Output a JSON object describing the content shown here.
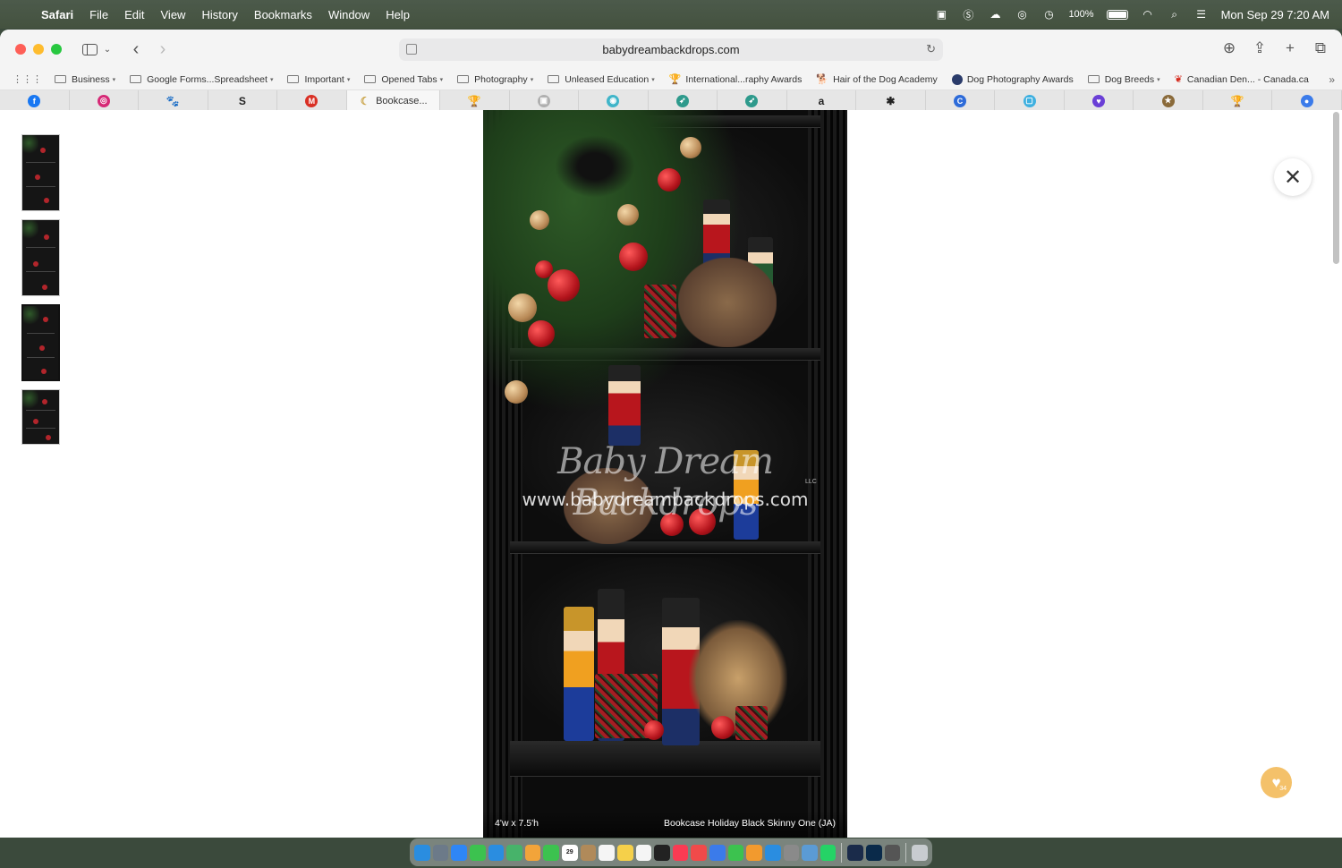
{
  "menubar": {
    "app_name": "Safari",
    "items": [
      "File",
      "Edit",
      "View",
      "History",
      "Bookmarks",
      "Window",
      "Help"
    ],
    "battery": "100%",
    "datetime": "Mon Sep 29  7:20 AM"
  },
  "browser": {
    "url": "babydreambackdrops.com",
    "bookmarks": [
      {
        "label": "Business",
        "type": "folder"
      },
      {
        "label": "Google Forms...Spreadsheet",
        "type": "folder"
      },
      {
        "label": "Important",
        "type": "folder"
      },
      {
        "label": "Opened Tabs",
        "type": "folder"
      },
      {
        "label": "Photography",
        "type": "folder"
      },
      {
        "label": "Unleased Education",
        "type": "folder"
      },
      {
        "label": "International...raphy Awards",
        "type": "link",
        "icon": "trophy-icon"
      },
      {
        "label": "Hair of the Dog Academy",
        "type": "link",
        "icon": "dog-icon"
      },
      {
        "label": "Dog Photography Awards",
        "type": "link",
        "icon": "globe-icon"
      },
      {
        "label": "Dog Breeds",
        "type": "folder"
      },
      {
        "label": "Canadian Den... - Canada.ca",
        "type": "link",
        "icon": "maple-leaf-icon"
      }
    ],
    "active_tab_label": "Bookcase...",
    "tabs": [
      {
        "icon": "facebook-icon",
        "glyph": "f",
        "color": "#1877f2"
      },
      {
        "icon": "instagram-icon",
        "glyph": "◎",
        "color": "#d62976"
      },
      {
        "icon": "paw-icon",
        "glyph": "🐾",
        "color": ""
      },
      {
        "icon": "s-logo-icon",
        "glyph": "S",
        "color": ""
      },
      {
        "icon": "gmail-icon",
        "glyph": "M",
        "color": "#d93025"
      },
      {
        "icon": "moon-icon",
        "glyph": "☾",
        "color": "",
        "active": true
      },
      {
        "icon": "trophy-icon",
        "glyph": "🏆",
        "color": ""
      },
      {
        "icon": "image-icon",
        "glyph": "▣",
        "color": "#b0b0b0"
      },
      {
        "icon": "swirl-icon",
        "glyph": "◉",
        "color": "#40b5c9"
      },
      {
        "icon": "bird-icon",
        "glyph": "➶",
        "color": "#2e9a8c"
      },
      {
        "icon": "bird-icon-2",
        "glyph": "➶",
        "color": "#2e9a8c"
      },
      {
        "icon": "amazon-icon",
        "glyph": "a",
        "color": ""
      },
      {
        "icon": "chatgpt-icon",
        "glyph": "✱",
        "color": ""
      },
      {
        "icon": "canva-icon",
        "glyph": "C",
        "color": "#2d6bd9"
      },
      {
        "icon": "screen-icon",
        "glyph": "▢",
        "color": "#3fb0e0"
      },
      {
        "icon": "heart-chat-icon",
        "glyph": "♥",
        "color": "#6a3fd6"
      },
      {
        "icon": "star-icon",
        "glyph": "★",
        "color": "#8a6a3a"
      },
      {
        "icon": "trophy-icon-2",
        "glyph": "🏆",
        "color": ""
      },
      {
        "icon": "bluesky-icon",
        "glyph": "●",
        "color": "#3b7bea"
      }
    ]
  },
  "product": {
    "watermark_script": "Baby Dream Backdrops",
    "watermark_llc": "LLC",
    "watermark_url": "www.babydreambackdrops.com",
    "size_label": "4'w x 7.5'h",
    "name_label": "Bookcase Holiday Black Skinny One (JA)",
    "thumbnail_count": 4,
    "selected_thumbnail": 3
  },
  "favorites_badge": "34",
  "dock": {
    "calendar_date": "29",
    "apps": [
      "Finder",
      "Launchpad",
      "Safari",
      "Messages",
      "Mail",
      "Maps",
      "Photos",
      "FaceTime",
      "Calendar",
      "Contacts",
      "Reminders",
      "Notes",
      "Freeform",
      "TV",
      "Music",
      "News",
      "Keynote",
      "Numbers",
      "Pages",
      "App Store",
      "System Settings",
      "Preview",
      "WhatsApp",
      "Lightroom Classic",
      "Photoshop",
      "Calculator",
      "Trash"
    ]
  },
  "colors": {
    "menubar_bg": "#4c5a4b",
    "accent_heart": "#f4c16a",
    "image_bg": "#0c0c0c"
  }
}
